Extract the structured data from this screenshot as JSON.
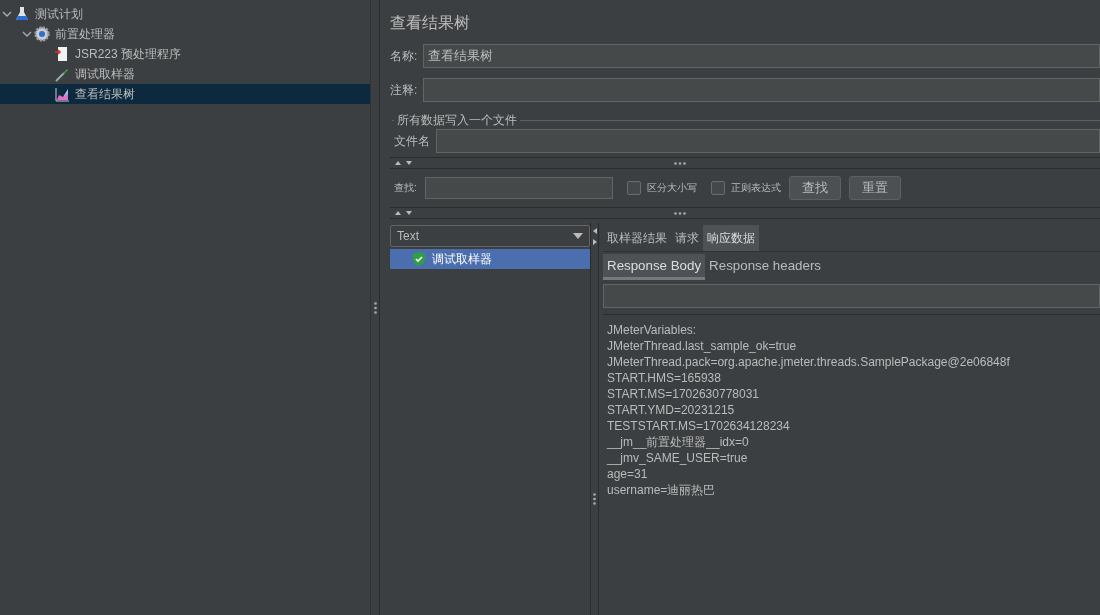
{
  "tree": [
    {
      "label": "测试计划",
      "kind": "flask",
      "expanded": true,
      "selected": false,
      "children": [
        {
          "label": "前置处理器",
          "kind": "gear",
          "expanded": true,
          "selected": false,
          "children": [
            {
              "label": "JSR223 预处理程序",
              "kind": "script",
              "selected": false
            },
            {
              "label": "调试取样器",
              "kind": "dropper",
              "selected": false
            },
            {
              "label": "查看结果树",
              "kind": "graph",
              "selected": true
            }
          ]
        }
      ]
    }
  ],
  "panel": {
    "title": "查看结果树",
    "name_label": "名称:",
    "name_value": "查看结果树",
    "comment_label": "注释:",
    "file_group": "所有数据写入一个文件",
    "file_label": "文件名"
  },
  "search": {
    "label": "查找:",
    "options": [
      {
        "label": "区分大小写",
        "checked": false
      },
      {
        "label": "正则表达式",
        "checked": false
      }
    ],
    "buttons": [
      "查找",
      "重置"
    ]
  },
  "results": {
    "renderer": "Text",
    "samples": [
      {
        "label": "调试取样器",
        "passed": true,
        "selected": true
      }
    ],
    "tabs": [
      {
        "label": "取样器结果",
        "selected": false
      },
      {
        "label": "请求",
        "selected": false
      },
      {
        "label": "响应数据",
        "selected": true
      }
    ],
    "subtabs": [
      {
        "label": "Response Body",
        "selected": true
      },
      {
        "label": "Response headers",
        "selected": false
      }
    ],
    "lines": [
      "JMeterVariables:",
      "JMeterThread.last_sample_ok=true",
      "JMeterThread.pack=org.apache.jmeter.threads.SamplePackage@2e06848f",
      "START.HMS=165938",
      "START.MS=1702630778031",
      "START.YMD=20231215",
      "TESTSTART.MS=1702634128234",
      "__jm__前置处理器__idx=0",
      "__jmv_SAME_USER=true",
      "age=31",
      "username=迪丽热巴"
    ]
  }
}
